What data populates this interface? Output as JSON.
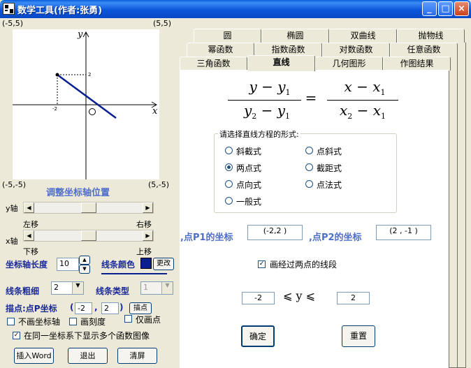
{
  "window": {
    "title": "数学工具(作者:张勇)",
    "controls": {
      "minimize": "_",
      "maximize": "□",
      "close": "×"
    }
  },
  "graph": {
    "corner_top_left": "(-5,5)",
    "corner_top_right": "(5,5)",
    "corner_bottom_left": "(-5,-5)",
    "corner_bottom_right": "(5,-5)",
    "x_axis_label": "x",
    "y_axis_label": "y",
    "tick_x": "-2",
    "tick_y": "2"
  },
  "axis_adjust": {
    "heading": "调整坐标轴位置",
    "y_axis": "y轴",
    "x_axis": "x轴",
    "left_move": "左移",
    "right_move": "右移",
    "down_move": "下移",
    "up_move": "上移"
  },
  "settings": {
    "axis_length_label": "坐标轴长度",
    "axis_length_value": "10",
    "line_color_label": "线条颜色",
    "line_color": "#0a1f8f",
    "change_button": "更改",
    "line_width_label": "线条粗细",
    "line_width_value": "2",
    "line_type_label": "线条类型",
    "line_type_value": "1",
    "plot_point_label": "描点:点P坐标",
    "point_x": "-2",
    "point_y": "2",
    "plot_point_button": "描点",
    "no_axes": "不画坐标轴",
    "draw_ticks": "画刻度",
    "points_only": "仅画点",
    "multi_graph": "在同一坐标系下显示多个函数图像"
  },
  "bottom_buttons": {
    "insert_word": "插入Word",
    "exit": "退出",
    "clear": "清屏"
  },
  "tabs": {
    "row1": [
      "圆",
      "椭圆",
      "双曲线",
      "抛物线"
    ],
    "row2": [
      "幂函数",
      "指数函数",
      "对数函数",
      "任意函数"
    ],
    "row3": [
      "三角函数",
      "直线",
      "几何图形",
      "作图结果"
    ]
  },
  "line_tab": {
    "formula": {
      "y": "y",
      "y1": "y",
      "y2": "y",
      "x": "x",
      "x1": "x",
      "x2": "x",
      "sub1": "1",
      "sub2": "2",
      "minus": "−",
      "equals": "="
    },
    "group_title": "请选择直线方程的形式:",
    "options": [
      "斜截式",
      "点斜式",
      "两点式",
      "截距式",
      "点向式",
      "点法式",
      "一般式"
    ],
    "selected": "两点式",
    "p1_label": ",点P1的坐标",
    "p1_value": "(-2,2 )",
    "p2_label": ",点P2的坐标",
    "p2_value": "(2 , -1 )",
    "segment_checkbox": "画经过两点的线段",
    "range_min": "-2",
    "range_symbol": "⩽ y ⩽",
    "range_max": "2",
    "ok_button": "确定",
    "reset_button": "重置"
  }
}
